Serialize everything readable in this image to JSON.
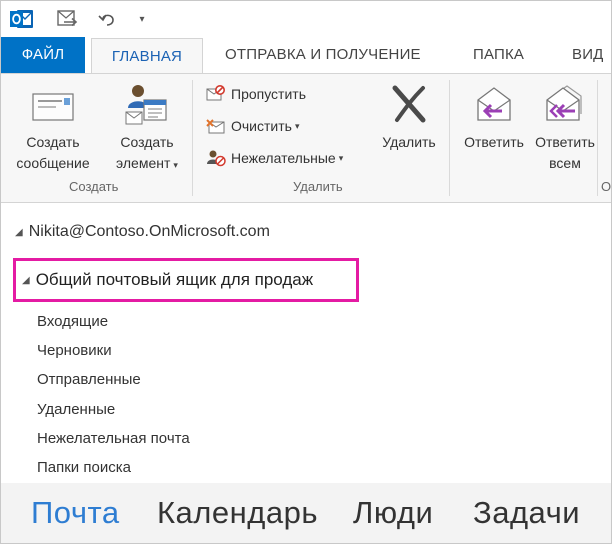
{
  "tabs": {
    "file": "ФАЙЛ",
    "home": "ГЛАВНАЯ",
    "send_receive": "ОТПРАВКА И ПОЛУЧЕНИЕ",
    "folder": "ПАПКА",
    "view": "ВИД"
  },
  "ribbon": {
    "new_message": [
      "Создать",
      "сообщение"
    ],
    "new_item": [
      "Создать",
      "элемент"
    ],
    "group_create": "Создать",
    "ignore": "Пропустить",
    "clean_up": "Очистить",
    "junk": "Нежелательные",
    "delete": "Удалить",
    "group_delete": "Удалить",
    "reply": "Ответить",
    "reply_all": [
      "Ответить",
      "всем"
    ],
    "group_respond_partial": "О"
  },
  "folders": {
    "account": "Nikita@Contoso.OnMicrosoft.com",
    "shared_mailbox": "Общий почтовый ящик для продаж",
    "items": [
      "Входящие",
      "Черновики",
      "Отправленные",
      "Удаленные",
      "Нежелательная почта",
      "Папки поиска"
    ]
  },
  "nav": {
    "mail": "Почта",
    "calendar": "Календарь",
    "people": "Люди",
    "tasks": "Задачи"
  },
  "colors": {
    "file_tab": "#0072c6",
    "active_tab_text": "#1b62b4",
    "highlight_border": "#e41ba3",
    "active_nav": "#2e7dd2",
    "reply_arrow": "#9b3fb5"
  }
}
